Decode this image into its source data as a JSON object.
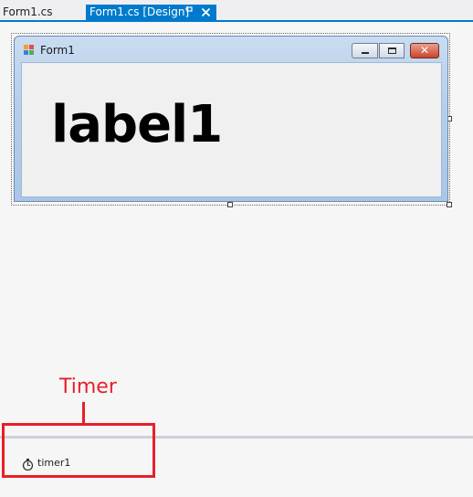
{
  "tabs": [
    {
      "label": "Form1.cs",
      "active": false
    },
    {
      "label": "Form1.cs [Design]",
      "active": true
    }
  ],
  "tab_icons": {
    "pin": "pin-icon",
    "close": "close-icon"
  },
  "form": {
    "title": "Form1",
    "icon": "form-icon",
    "label_text": "label1",
    "buttons": {
      "minimize": "minimize-icon",
      "maximize": "maximize-icon",
      "close": "✕"
    }
  },
  "tray": {
    "items": [
      {
        "label": "timer1",
        "icon": "stopwatch-icon"
      }
    ]
  },
  "annotation": {
    "label": "Timer"
  },
  "colors": {
    "tab_active": "#007acc",
    "annotation": "#e81f2b",
    "close_button": "#c8452c"
  }
}
